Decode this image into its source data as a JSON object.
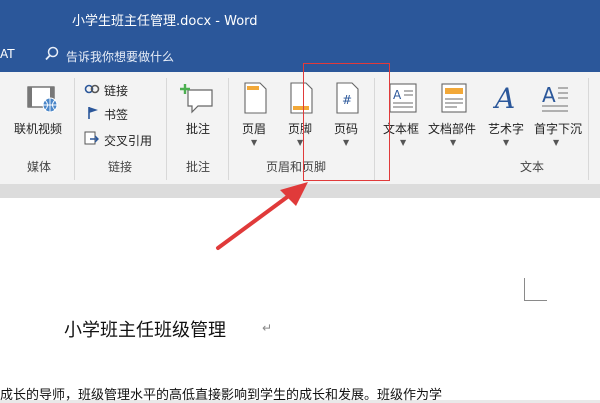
{
  "window": {
    "title": "小学生班主任管理.docx  -  Word"
  },
  "tellme": {
    "tab_fragment": "AT",
    "placeholder": "告诉我你想要做什么"
  },
  "ribbon": {
    "media": {
      "online_video": "联机视频",
      "group": "媒体"
    },
    "links": {
      "link": "链接",
      "bookmark": "书签",
      "cross_ref": "交叉引用",
      "group": "链接"
    },
    "comments": {
      "comment": "批注",
      "group": "批注"
    },
    "header_footer": {
      "header": "页眉",
      "footer": "页脚",
      "page_number": "页码",
      "group": "页眉和页脚"
    },
    "text": {
      "textbox": "文本框",
      "quick_parts": "文档部件",
      "wordart": "艺术字",
      "dropcap": "首字下沉",
      "group": "文本"
    }
  },
  "document": {
    "title": "小学班主任班级管理",
    "paragraph_mark": "↵",
    "body_line": "成长的导师，班级管理水平的高低直接影响到学生的成长和发展。班级作为学"
  },
  "colors": {
    "word_blue": "#2b579a",
    "highlight": "#e03a3a"
  }
}
